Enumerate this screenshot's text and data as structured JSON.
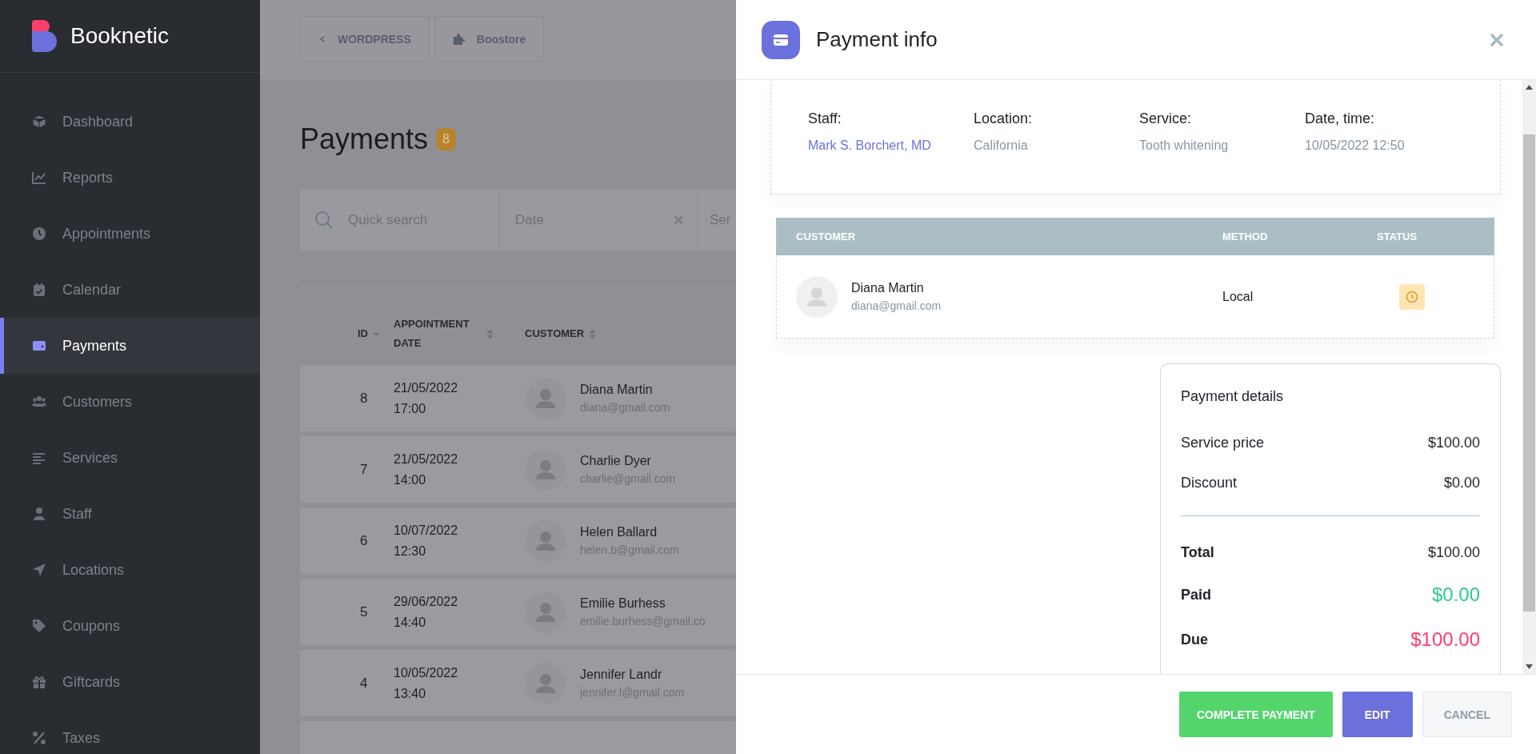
{
  "sidebar": {
    "brand": "Booknetic",
    "items": [
      {
        "label": "Dashboard",
        "selected": false
      },
      {
        "label": "Reports",
        "selected": false
      },
      {
        "label": "Appointments",
        "selected": false
      },
      {
        "label": "Calendar",
        "selected": false
      },
      {
        "label": "Payments",
        "selected": true
      },
      {
        "label": "Customers",
        "selected": false
      },
      {
        "label": "Services",
        "selected": false
      },
      {
        "label": "Staff",
        "selected": false
      },
      {
        "label": "Locations",
        "selected": false
      },
      {
        "label": "Coupons",
        "selected": false
      },
      {
        "label": "Giftcards",
        "selected": false
      },
      {
        "label": "Taxes",
        "selected": false
      }
    ]
  },
  "topbar": {
    "buttons": [
      "WORDPRESS",
      "Boostore"
    ]
  },
  "page": {
    "title": "Payments",
    "count": "8"
  },
  "filters": {
    "search_placeholder": "Quick search",
    "date_placeholder": "Date",
    "column_3_placeholder": "Ser"
  },
  "table": {
    "columns": [
      "ID",
      "APPOINTMENT DATE",
      "CUSTOMER"
    ],
    "rows": [
      {
        "id": "8",
        "date": "21/05/2022",
        "time": "17:00",
        "customer": "Diana Martin",
        "email": "diana@gmail.com"
      },
      {
        "id": "7",
        "date": "21/05/2022",
        "time": "14:00",
        "customer": "Charlie Dyer",
        "email": "charlie@gmail.com"
      },
      {
        "id": "6",
        "date": "10/07/2022",
        "time": "12:30",
        "customer": "Helen Ballard",
        "email": "helen.b@gmail.com"
      },
      {
        "id": "5",
        "date": "29/06/2022",
        "time": "14:40",
        "customer": "Emilie Burhess",
        "email": "emilie.burhess@gmail.co"
      },
      {
        "id": "4",
        "date": "10/05/2022",
        "time": "13:40",
        "customer": "Jennifer Landr",
        "email": "jennifer.l@gmail.com"
      }
    ]
  },
  "panel": {
    "title": "Payment info",
    "info": [
      {
        "label": "Staff:",
        "value": "Mark S. Borchert, MD",
        "kind": "link"
      },
      {
        "label": "Location:",
        "value": "California",
        "kind": "text"
      },
      {
        "label": "Service:",
        "value": "Tooth whitening",
        "kind": "text"
      },
      {
        "label": "Date, time:",
        "value": "10/05/2022 12:50",
        "kind": "text"
      }
    ],
    "customer_table": {
      "columns": [
        "CUSTOMER",
        "METHOD",
        "STATUS"
      ],
      "rows": [
        {
          "name": "Diana Martin",
          "email": "diana@gmail.com",
          "method": "Local",
          "kind": "pending"
        }
      ]
    },
    "details": {
      "title": "Payment details",
      "rows": [
        {
          "label": "Service price",
          "value": "$100.00",
          "kind": "item"
        },
        {
          "label": "Discount",
          "value": "$0.00",
          "kind": "item"
        },
        {
          "label": "Total",
          "value": "$100.00",
          "kind": "total"
        },
        {
          "label": "Paid",
          "value": "$0.00",
          "kind": "paid"
        },
        {
          "label": "Due",
          "value": "$100.00",
          "kind": "due"
        }
      ]
    },
    "buttons": [
      {
        "label": "COMPLETE PAYMENT",
        "kind": "success"
      },
      {
        "label": "EDIT",
        "kind": "primary"
      },
      {
        "label": "CANCEL",
        "kind": "secondary"
      }
    ]
  }
}
